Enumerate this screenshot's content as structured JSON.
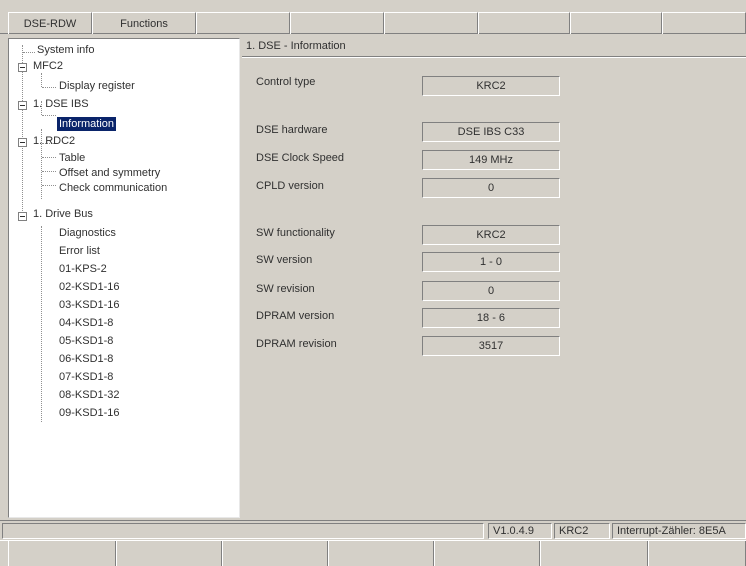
{
  "menu": {
    "items": [
      "DSE-RDW",
      "Functions"
    ]
  },
  "tree": {
    "items": [
      {
        "label": "System info",
        "level": 1
      },
      {
        "label": "MFC2",
        "level": 0
      },
      {
        "label": "Display register",
        "level": 2
      },
      {
        "label": "1. DSE IBS",
        "level": 0
      },
      {
        "label": "Information",
        "level": 2,
        "selected": true
      },
      {
        "label": "1. RDC2",
        "level": 0
      },
      {
        "label": "Table",
        "level": 2
      },
      {
        "label": "Offset and symmetry",
        "level": 2
      },
      {
        "label": "Check communication",
        "level": 2
      },
      {
        "label": "1. Drive Bus",
        "level": 0
      },
      {
        "label": "Diagnostics",
        "level": 2
      },
      {
        "label": "Error list",
        "level": 2
      },
      {
        "label": "01-KPS-2",
        "level": 2
      },
      {
        "label": "02-KSD1-16",
        "level": 2
      },
      {
        "label": "03-KSD1-16",
        "level": 2
      },
      {
        "label": "04-KSD1-8",
        "level": 2
      },
      {
        "label": "05-KSD1-8",
        "level": 2
      },
      {
        "label": "06-KSD1-8",
        "level": 2
      },
      {
        "label": "07-KSD1-8",
        "level": 2
      },
      {
        "label": "08-KSD1-32",
        "level": 2
      },
      {
        "label": "09-KSD1-16",
        "level": 2
      }
    ]
  },
  "main": {
    "title": "1. DSE - Information",
    "fields": [
      {
        "label": "Control type",
        "value": "KRC2"
      },
      {
        "label": "DSE hardware",
        "value": "DSE IBS C33"
      },
      {
        "label": "DSE Clock Speed",
        "value": "149 MHz"
      },
      {
        "label": "CPLD version",
        "value": "0"
      },
      {
        "label": "SW functionality",
        "value": "KRC2"
      },
      {
        "label": "SW version",
        "value": "1 - 0"
      },
      {
        "label": "SW revision",
        "value": "0"
      },
      {
        "label": "DPRAM version",
        "value": "18 - 6"
      },
      {
        "label": "DPRAM revision",
        "value": "3517"
      }
    ]
  },
  "status": {
    "version": "V1.0.4.9",
    "control": "KRC2",
    "interrupt": "Interrupt-Zähler: 8E5A"
  },
  "colors": {
    "background": "#d4d0c8",
    "selection": "#0a246a",
    "tree_background": "#ffffff"
  }
}
